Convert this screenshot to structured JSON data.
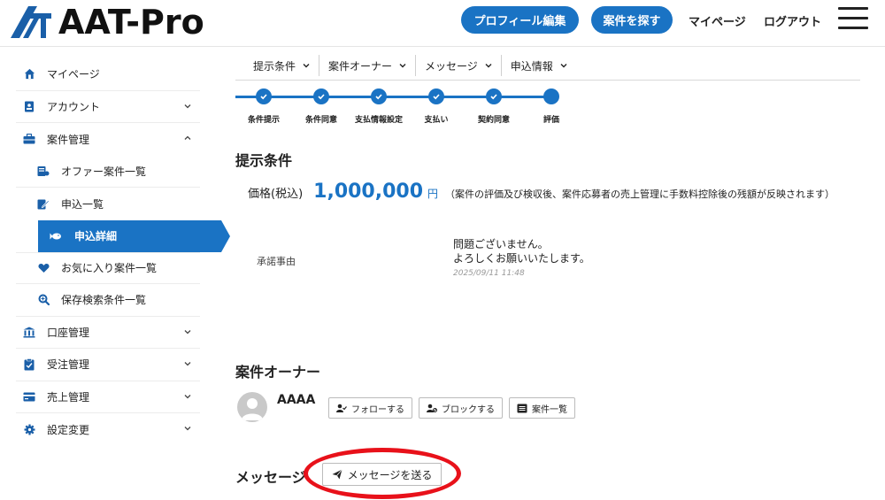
{
  "header": {
    "brand": "AAT-Pro",
    "profile_edit": "プロフィール編集",
    "find_jobs": "案件を探す",
    "mypage": "マイページ",
    "logout": "ログアウト"
  },
  "sidebar": {
    "items": [
      {
        "label": "マイページ",
        "icon": "home-icon"
      },
      {
        "label": "アカウント",
        "icon": "id-card-icon"
      },
      {
        "label": "案件管理",
        "icon": "briefcase-icon"
      },
      {
        "label": "オファー案件一覧",
        "icon": "offer-list-icon"
      },
      {
        "label": "申込一覧",
        "icon": "application-list-icon"
      },
      {
        "label": "申込詳細",
        "icon": "fish-icon"
      },
      {
        "label": "お気に入り案件一覧",
        "icon": "heart-icon"
      },
      {
        "label": "保存検索条件一覧",
        "icon": "search-icon"
      },
      {
        "label": "口座管理",
        "icon": "bank-icon"
      },
      {
        "label": "受注管理",
        "icon": "clipboard-icon"
      },
      {
        "label": "売上管理",
        "icon": "card-icon"
      },
      {
        "label": "設定変更",
        "icon": "gear-icon"
      }
    ]
  },
  "tabs": [
    "提示条件",
    "案件オーナー",
    "メッセージ",
    "申込情報"
  ],
  "steps": [
    "条件提示",
    "条件同意",
    "支払情報設定",
    "支払い",
    "契約同意",
    "評価"
  ],
  "offer": {
    "title": "提示条件",
    "price_label": "価格(税込)",
    "price_value": "1,000,000",
    "price_unit": "円",
    "price_note": "（案件の評価及び検収後、案件応募者の売上管理に手数料控除後の残額が反映されます）",
    "reason_label": "承諾事由",
    "reason_line1": "問題ございません。",
    "reason_line2": "よろしくお願いいたします。",
    "reason_date": "2025/09/11 11:48"
  },
  "owner": {
    "title": "案件オーナー",
    "name": "AAAA",
    "follow": "フォローする",
    "block": "ブロックする",
    "jobs": "案件一覧"
  },
  "message": {
    "title": "メッセージ",
    "send": "メッセージを送る"
  },
  "colors": {
    "accent": "#1a73c4",
    "highlight": "#e8111a"
  }
}
